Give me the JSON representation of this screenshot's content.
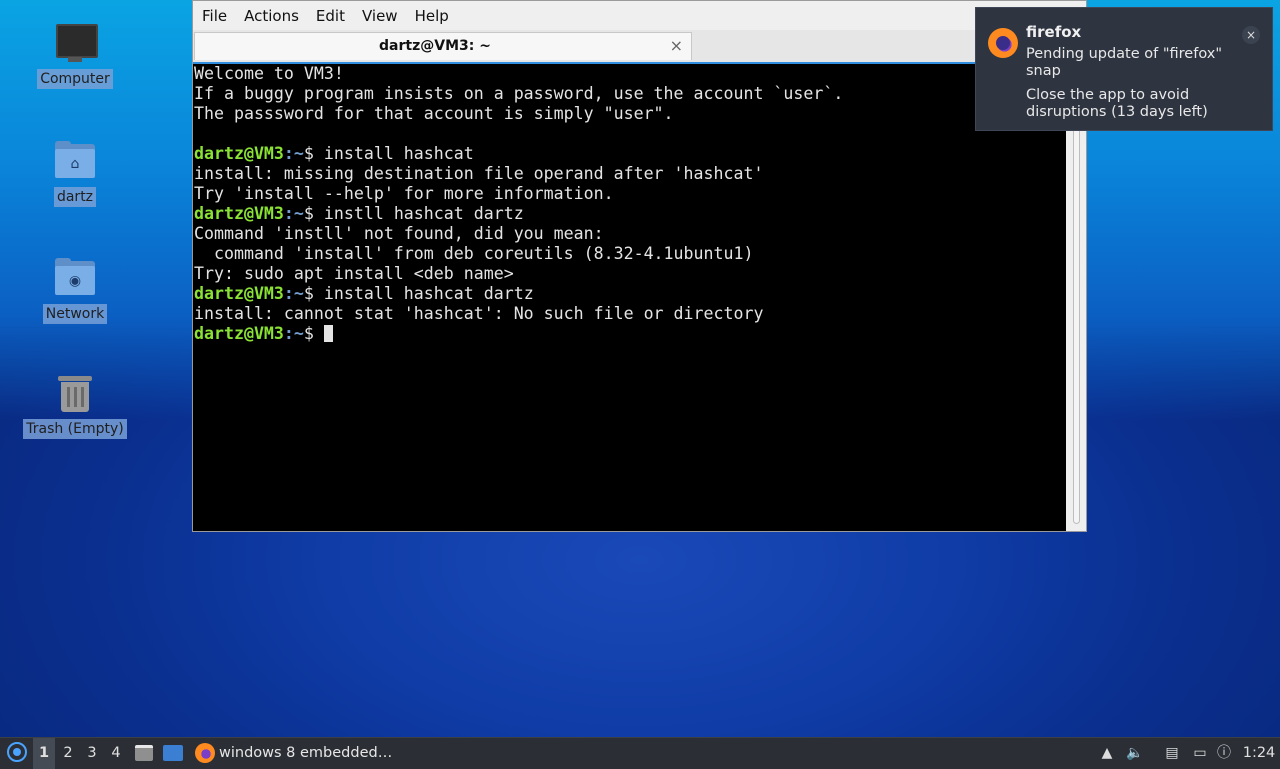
{
  "desktop": {
    "icons": [
      {
        "label": "Computer",
        "icon": "computer-icon"
      },
      {
        "label": "dartz",
        "icon": "home-folder-icon"
      },
      {
        "label": "Network",
        "icon": "network-folder-icon"
      },
      {
        "label": "Trash (Empty)",
        "icon": "trash-icon"
      }
    ]
  },
  "terminal": {
    "menu": [
      "File",
      "Actions",
      "Edit",
      "View",
      "Help"
    ],
    "tab_title": "dartz@VM3: ~",
    "tab_close": "×",
    "prompt_user": "dartz@VM3",
    "prompt_path": ":~",
    "prompt_sym": "$ ",
    "output": [
      "Welcome to VM3!",
      "If a buggy program insists on a password, use the account `user`.",
      "The passsword for that account is simply \"user\".",
      ""
    ],
    "session": [
      {
        "cmd": "install hashcat",
        "out": [
          "install: missing destination file operand after 'hashcat'",
          "Try 'install --help' for more information."
        ]
      },
      {
        "cmd": "instll hashcat dartz",
        "out": [
          "Command 'instll' not found, did you mean:",
          "  command 'install' from deb coreutils (8.32-4.1ubuntu1)",
          "Try: sudo apt install <deb name>"
        ]
      },
      {
        "cmd": "install hashcat dartz",
        "out": [
          "install: cannot stat 'hashcat': No such file or directory"
        ]
      }
    ]
  },
  "notification": {
    "app": "firefox",
    "summary": "Pending update of \"firefox\" snap",
    "body": "Close the app to avoid disruptions (13 days left)",
    "close": "×"
  },
  "taskbar": {
    "workspaces": [
      "1",
      "2",
      "3",
      "4"
    ],
    "active_workspace": "1",
    "task_label": "windows 8 embedded…",
    "clock": "1:24"
  }
}
